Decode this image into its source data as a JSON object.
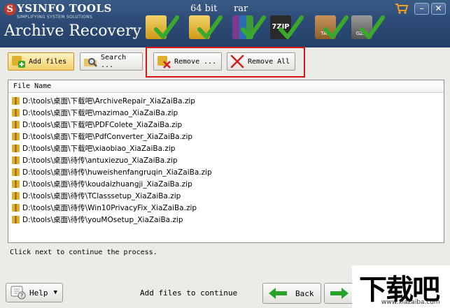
{
  "header": {
    "brand": "YSINFO TOOLS",
    "brand_tagline": "SIMPLIFYING SYSTEM SOLUTIONS",
    "app_title": "Archive Recovery",
    "format_labels": [
      "64 bit",
      "rar"
    ],
    "formats": [
      {
        "name": "zip-icon",
        "color": "#e0b02c"
      },
      {
        "name": "zip64-icon",
        "color": "#e0b02c"
      },
      {
        "name": "rar-icon",
        "color": "#7a3b8f"
      },
      {
        "name": "7zip-icon",
        "label": "7ZIP",
        "color": "#2a2a2a"
      },
      {
        "name": "tar-icon",
        "label": "TAR",
        "color": "#a8753b"
      },
      {
        "name": "gzip-icon",
        "label": "GZIP",
        "color": "#6b6b6b"
      }
    ],
    "window_buttons": {
      "minimize": "–",
      "close": "✕"
    }
  },
  "toolbar": {
    "add_files": "Add files",
    "search": "Search ...",
    "remove": "Remove ...",
    "remove_all": "Remove All"
  },
  "file_list": {
    "column_header": "File Name",
    "files": [
      "D:\\tools\\桌面\\下载吧\\ArchiveRepair_XiaZaiBa.zip",
      "D:\\tools\\桌面\\下载吧\\mazimao_XiaZaiBa.zip",
      "D:\\tools\\桌面\\下载吧\\PDFColete_XiaZaiBa.zip",
      "D:\\tools\\桌面\\下载吧\\PdfConverter_XiaZaiBa.zip",
      "D:\\tools\\桌面\\下载吧\\xiaobiao_XiaZaiBa.zip",
      "D:\\tools\\桌面\\待传\\antuxiezuo_XiaZaiBa.zip",
      "D:\\tools\\桌面\\待传\\huweishenfangruqin_XiaZaiBa.zip",
      "D:\\tools\\桌面\\待传\\koudaizhuangji_XiaZaiBa.zip",
      "D:\\tools\\桌面\\待传\\TClasssetup_XiaZaiBa.zip",
      "D:\\tools\\桌面\\待传\\Win10PrivacyFix_XiaZaiBa.zip",
      "D:\\tools\\桌面\\待传\\youMOsetup_XiaZaiBa.zip"
    ]
  },
  "status_text": "Click next to continue the process.",
  "footer": {
    "help": "Help",
    "hint": "Add files to continue",
    "back": "Back"
  },
  "watermark": {
    "text": "下载吧",
    "url": "www.xiazaiba.com"
  },
  "colors": {
    "header_bg": "#2d4b76",
    "highlight_border": "#d7151d",
    "check_green": "#3aa82b",
    "arrow_green": "#28a32a"
  }
}
